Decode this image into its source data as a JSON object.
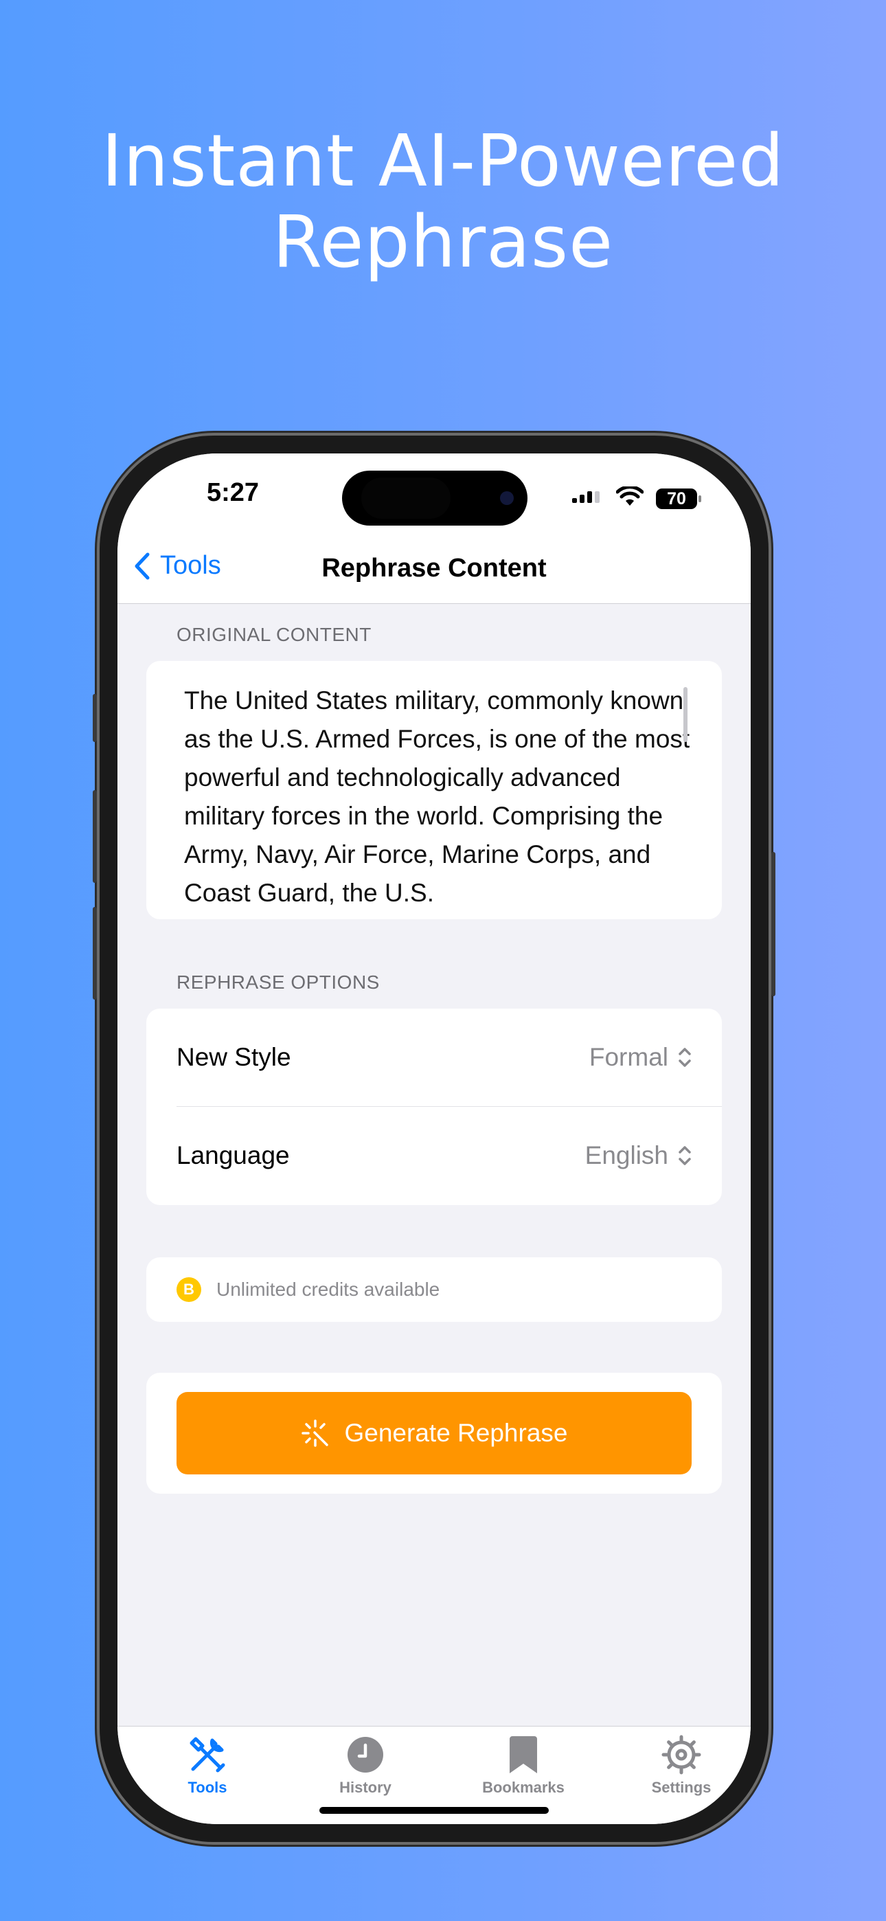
{
  "headline": {
    "line1": "Instant AI-Powered",
    "line2": "Rephrase"
  },
  "status_bar": {
    "time": "5:27",
    "battery": "70"
  },
  "nav": {
    "back_label": "Tools",
    "title": "Rephrase Content"
  },
  "original": {
    "section_label": "ORIGINAL CONTENT",
    "text": "The United States military, commonly known as the U.S. Armed Forces, is one of the most powerful and technologically advanced military forces in the world. Comprising the Army, Navy, Air Force, Marine Corps, and Coast Guard, the U.S."
  },
  "options": {
    "section_label": "REPHRASE OPTIONS",
    "style_label": "New Style",
    "style_value": "Formal",
    "language_label": "Language",
    "language_value": "English"
  },
  "credits": {
    "icon_letter": "B",
    "text": "Unlimited credits available"
  },
  "generate_label": "Generate Rephrase",
  "tabs": [
    {
      "label": "Tools",
      "icon": "tools-icon",
      "active": true
    },
    {
      "label": "History",
      "icon": "clock-icon",
      "active": false
    },
    {
      "label": "Bookmarks",
      "icon": "bookmark-icon",
      "active": false
    },
    {
      "label": "Settings",
      "icon": "gear-icon",
      "active": false
    }
  ],
  "colors": {
    "accent": "#0a7aff",
    "button": "#ff9500",
    "coin": "#ffc800"
  }
}
